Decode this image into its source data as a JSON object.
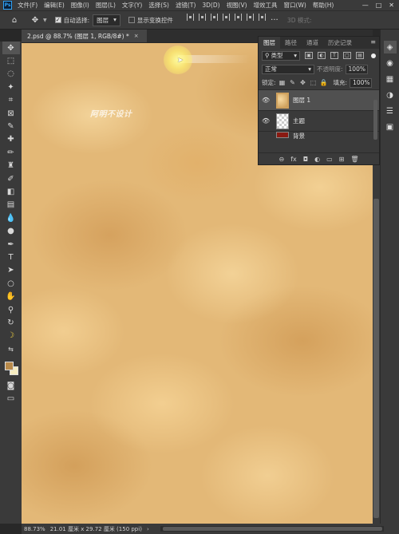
{
  "app": {
    "logo": "Ps"
  },
  "menu": [
    "文件(F)",
    "编辑(E)",
    "图像(I)",
    "图层(L)",
    "文字(Y)",
    "选择(S)",
    "滤镜(T)",
    "3D(D)",
    "视图(V)",
    "增效工具",
    "窗口(W)",
    "帮助(H)"
  ],
  "window_controls": {
    "minimize": "—",
    "maximize": "□",
    "close": "✕"
  },
  "options": {
    "auto_select_label": "自动选择:",
    "auto_select_value": "图层",
    "show_transform_label": "显示变换控件",
    "mode3d_label": "3D 模式:"
  },
  "document": {
    "tab_title": "2.psd @ 88.7% (图层 1, RGB/8#) *",
    "close": "×",
    "watermark": "阿明不设计"
  },
  "layers_panel": {
    "tabs": [
      "图层",
      "路径",
      "通道",
      "历史记录"
    ],
    "menu": "≡",
    "filter_label": "类型",
    "blend_mode": "正常",
    "opacity_label": "不透明度:",
    "opacity_value": "100%",
    "lock_label": "锁定:",
    "fill_label": "填充:",
    "fill_value": "100%",
    "layers": [
      {
        "name": "图层 1",
        "visible": true,
        "selected": true,
        "thumb": "clouds"
      },
      {
        "name": "主题",
        "visible": true,
        "selected": false,
        "thumb": "checker"
      },
      {
        "name": "背景",
        "visible": false,
        "selected": false,
        "thumb": "red"
      }
    ],
    "footer_icons": [
      "link-icon",
      "fx-icon",
      "mask-icon",
      "adjustment-icon",
      "group-icon",
      "new-layer-icon",
      "trash-icon"
    ],
    "footer_glyphs": [
      "⊖",
      "fx",
      "◘",
      "◐",
      "▭",
      "⊞",
      "🗑"
    ]
  },
  "status": {
    "zoom": "88.73%",
    "doc_size": "21.01 厘米 x 29.72 厘米 (150 ppi)",
    "arrow": "›"
  },
  "colors": {
    "foreground": "#b98a4a",
    "background": "#f6ecc0",
    "ui_bg": "#3a3a3a"
  }
}
